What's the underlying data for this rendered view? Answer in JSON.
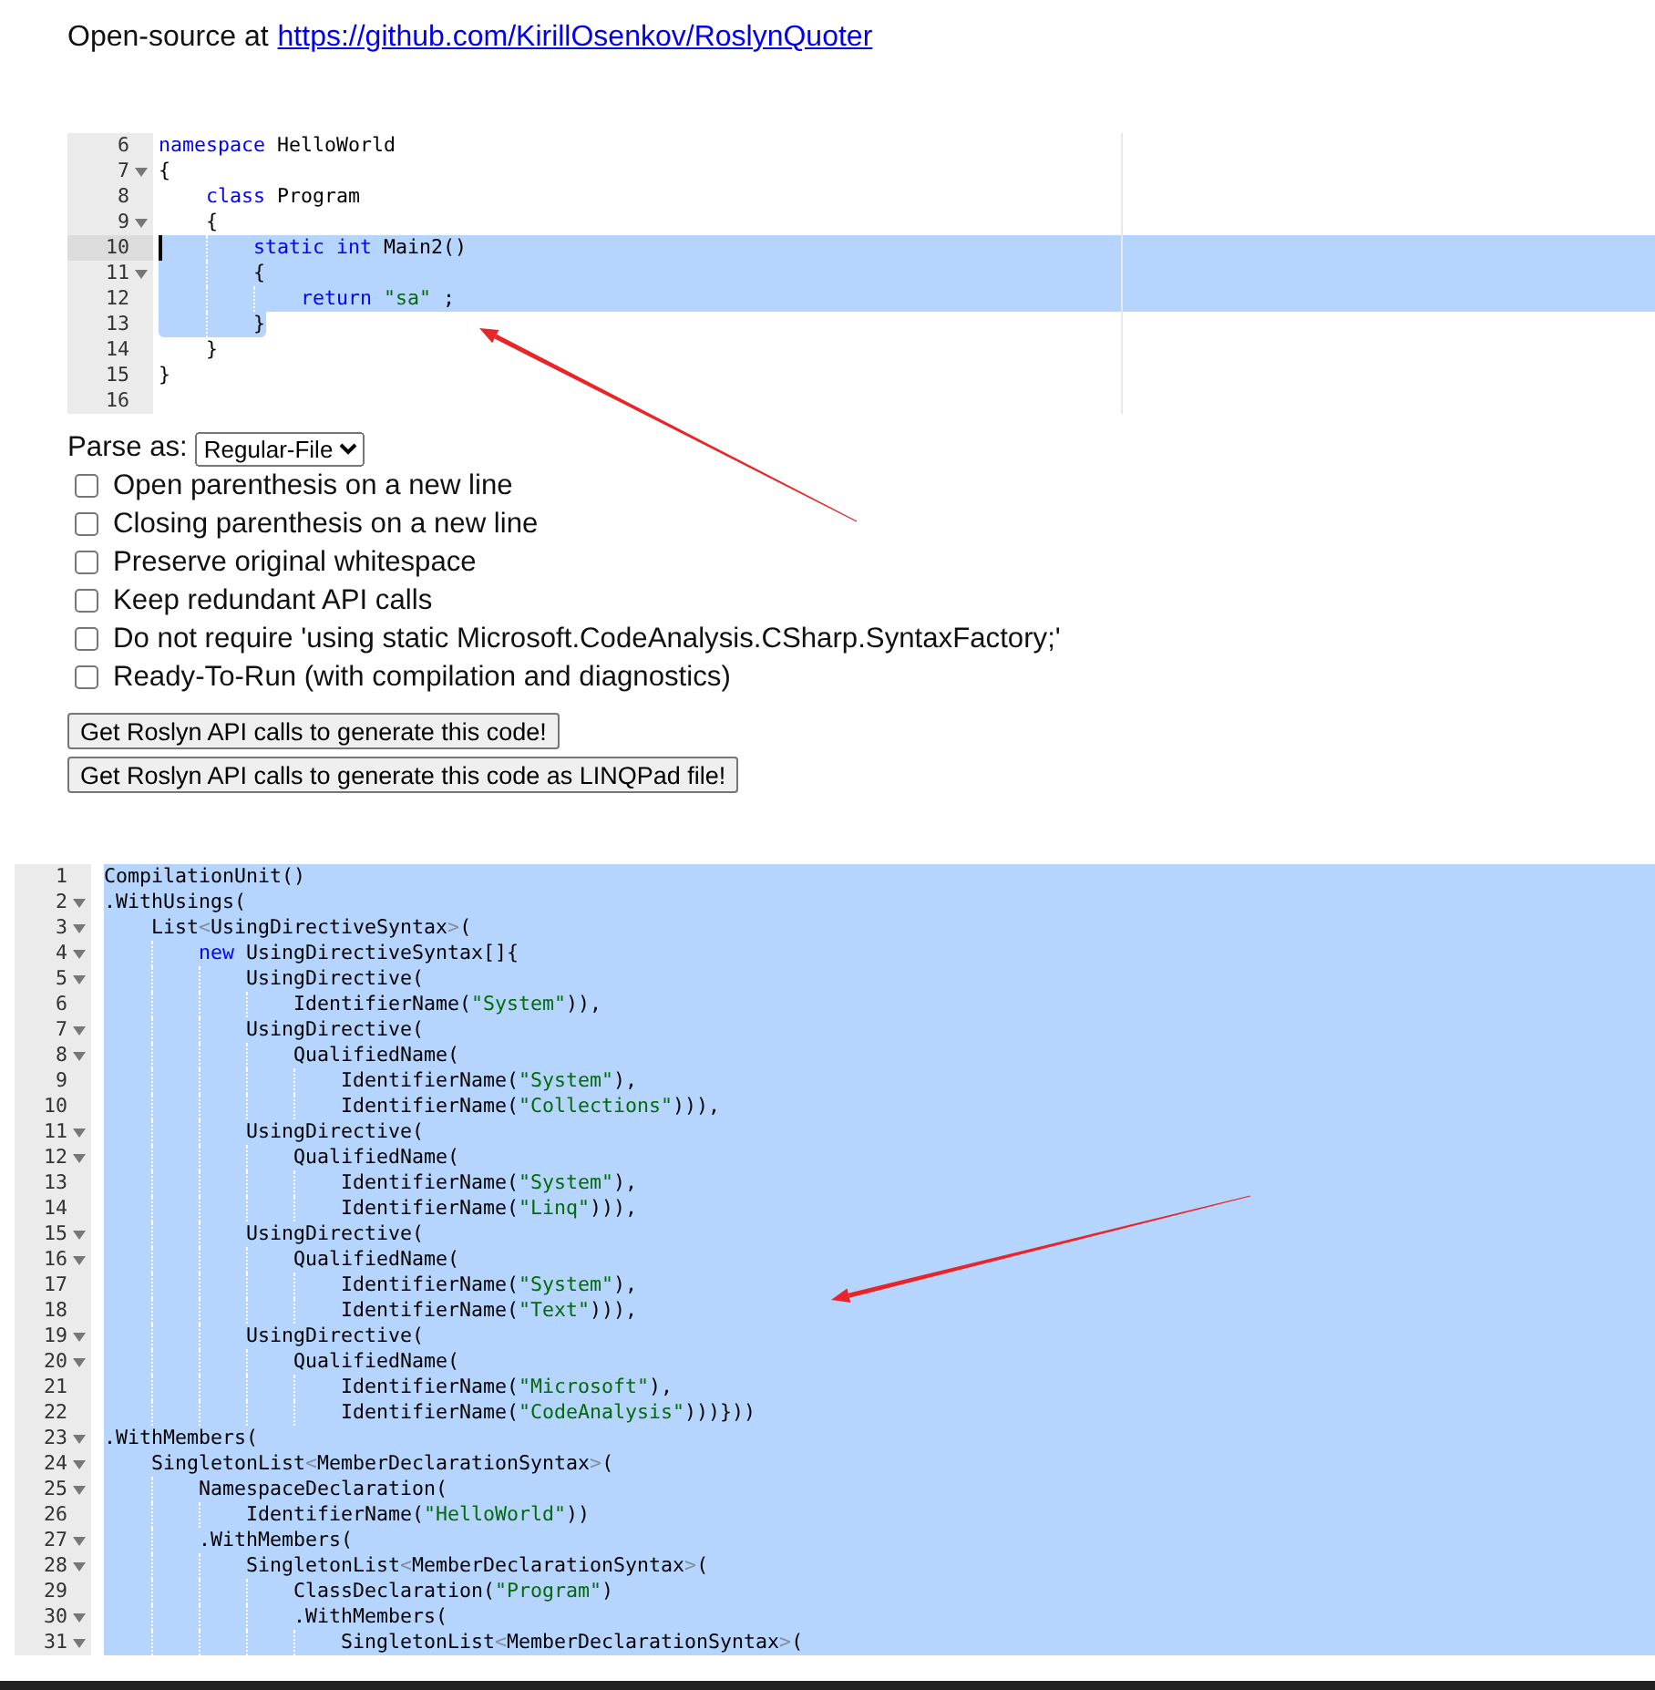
{
  "header": {
    "text": "Open-source at",
    "link": "https://github.com/KirillOsenkov/RoslynQuoter"
  },
  "source_editor": {
    "lines": [
      {
        "number": "6",
        "fold": false,
        "active": false,
        "selected": false,
        "tokens": [
          {
            "kind": "keyword",
            "text": "namespace"
          },
          {
            "kind": "plain",
            "text": " HelloWorld"
          }
        ]
      },
      {
        "number": "7",
        "fold": true,
        "active": false,
        "selected": false,
        "tokens": [
          {
            "kind": "plain",
            "text": "{"
          }
        ],
        "children": [
          {
            "number": "8",
            "fold": false,
            "active": false,
            "selected": false,
            "tokens": [
              {
                "kind": "keyword",
                "text": "class"
              },
              {
                "kind": "plain",
                "text": " Program"
              }
            ]
          },
          {
            "number": "9",
            "fold": true,
            "active": false,
            "selected": false,
            "tokens": [
              {
                "kind": "plain",
                "text": "{"
              }
            ],
            "children": [
              {
                "number": "10",
                "fold": false,
                "active": true,
                "selected": true,
                "tokens": [
                  {
                    "kind": "keyword",
                    "text": "static "
                  },
                  {
                    "kind": "keyword",
                    "text": "int"
                  },
                  {
                    "kind": "plain",
                    "text": " Main2()"
                  }
                ]
              },
              {
                "number": "11",
                "fold": true,
                "active": false,
                "selected": true,
                "tokens": [
                  {
                    "kind": "plain",
                    "text": "{"
                  }
                ],
                "children": [
                  {
                    "number": "12",
                    "fold": false,
                    "active": false,
                    "selected": true,
                    "tokens": [
                      {
                        "kind": "keyword",
                        "text": "return"
                      },
                      {
                        "kind": "string",
                        "text": " \"sa\""
                      },
                      {
                        "kind": "plain",
                        "text": " ;"
                      }
                    ]
                  }
                ]
              },
              {
                "number": "13",
                "fold": false,
                "active": false,
                "selected": true,
                "tokens": [
                  {
                    "kind": "plain",
                    "text": "}"
                  }
                ]
              }
            ]
          },
          {
            "number": "14",
            "fold": false,
            "active": false,
            "selected": false,
            "tokens": [
              {
                "kind": "plain",
                "text": "}"
              }
            ]
          }
        ]
      },
      {
        "number": "15",
        "fold": false,
        "active": false,
        "selected": false,
        "tokens": [
          {
            "kind": "plain",
            "text": "}"
          }
        ]
      },
      {
        "number": "16",
        "fold": false,
        "active": false,
        "selected": false
      }
    ]
  },
  "parse_as": {
    "label": "Parse as:",
    "value": "Regular-File"
  },
  "options": [
    {
      "label": "Open parenthesis on a new line",
      "checked": false
    },
    {
      "label": "Closing parenthesis on a new line",
      "checked": false
    },
    {
      "label": "Preserve original whitespace",
      "checked": false
    },
    {
      "label": "Keep redundant API calls",
      "checked": false
    },
    {
      "label": "Do not require 'using static Microsoft.CodeAnalysis.CSharp.SyntaxFactory;'",
      "checked": false
    },
    {
      "label": "Ready-To-Run (with compilation and diagnostics)",
      "checked": false
    }
  ],
  "buttons": [
    "Get Roslyn API calls to generate this code!",
    "Get Roslyn API calls to generate this code as LINQPad file!"
  ],
  "output_editor": {
    "lines": [
      {
        "number": "1",
        "fold": false,
        "active": false,
        "selected": true,
        "tokens": [
          {
            "kind": "plain",
            "text": "CompilationUnit()"
          }
        ]
      },
      {
        "number": "2",
        "fold": true,
        "active": false,
        "selected": true,
        "tokens": [
          {
            "kind": "plain",
            "text": ".WithUsings("
          }
        ],
        "children": [
          {
            "number": "3",
            "fold": true,
            "active": false,
            "selected": true,
            "tokens": [
              {
                "kind": "plain",
                "text": "List"
              },
              {
                "kind": "bracket",
                "text": "<"
              },
              {
                "kind": "plain",
                "text": "UsingDirectiveSyntax"
              },
              {
                "kind": "bracket",
                "text": ">"
              },
              {
                "kind": "plain",
                "text": "("
              }
            ],
            "children": [
              {
                "number": "4",
                "fold": true,
                "active": false,
                "selected": true,
                "tokens": [
                  {
                    "kind": "keyword",
                    "text": "new"
                  },
                  {
                    "kind": "plain",
                    "text": " UsingDirectiveSyntax[]{"
                  }
                ],
                "children": [
                  {
                    "number": "5",
                    "fold": true,
                    "active": false,
                    "selected": true,
                    "tokens": [
                      {
                        "kind": "plain",
                        "text": "UsingDirective("
                      }
                    ],
                    "children": [
                      {
                        "number": "6",
                        "fold": false,
                        "active": false,
                        "selected": true,
                        "tokens": [
                          {
                            "kind": "plain",
                            "text": "IdentifierName("
                          },
                          {
                            "kind": "string",
                            "text": "\"System\""
                          },
                          {
                            "kind": "plain",
                            "text": ")),"
                          }
                        ]
                      }
                    ]
                  },
                  {
                    "number": "7",
                    "fold": true,
                    "active": false,
                    "selected": true,
                    "tokens": [
                      {
                        "kind": "plain",
                        "text": "UsingDirective("
                      }
                    ],
                    "children": [
                      {
                        "number": "8",
                        "fold": true,
                        "active": false,
                        "selected": true,
                        "tokens": [
                          {
                            "kind": "plain",
                            "text": "QualifiedName("
                          }
                        ],
                        "children": [
                          {
                            "number": "9",
                            "fold": false,
                            "active": false,
                            "selected": true,
                            "tokens": [
                              {
                                "kind": "plain",
                                "text": "IdentifierName("
                              },
                              {
                                "kind": "string",
                                "text": "\"System\""
                              },
                              {
                                "kind": "plain",
                                "text": "),"
                              }
                            ]
                          },
                          {
                            "number": "10",
                            "fold": false,
                            "active": false,
                            "selected": true,
                            "tokens": [
                              {
                                "kind": "plain",
                                "text": "IdentifierName("
                              },
                              {
                                "kind": "string",
                                "text": "\"Collections\""
                              },
                              {
                                "kind": "plain",
                                "text": "))),"
                              }
                            ]
                          }
                        ]
                      }
                    ]
                  },
                  {
                    "number": "11",
                    "fold": true,
                    "active": false,
                    "selected": true,
                    "tokens": [
                      {
                        "kind": "plain",
                        "text": "UsingDirective("
                      }
                    ],
                    "children": [
                      {
                        "number": "12",
                        "fold": true,
                        "active": false,
                        "selected": true,
                        "tokens": [
                          {
                            "kind": "plain",
                            "text": "QualifiedName("
                          }
                        ],
                        "children": [
                          {
                            "number": "13",
                            "fold": false,
                            "active": false,
                            "selected": true,
                            "tokens": [
                              {
                                "kind": "plain",
                                "text": "IdentifierName("
                              },
                              {
                                "kind": "string",
                                "text": "\"System\""
                              },
                              {
                                "kind": "plain",
                                "text": "),"
                              }
                            ]
                          },
                          {
                            "number": "14",
                            "fold": false,
                            "active": false,
                            "selected": true,
                            "tokens": [
                              {
                                "kind": "plain",
                                "text": "IdentifierName("
                              },
                              {
                                "kind": "string",
                                "text": "\"Linq\""
                              },
                              {
                                "kind": "plain",
                                "text": "))),"
                              }
                            ]
                          }
                        ]
                      }
                    ]
                  },
                  {
                    "number": "15",
                    "fold": true,
                    "active": false,
                    "selected": true,
                    "tokens": [
                      {
                        "kind": "plain",
                        "text": "UsingDirective("
                      }
                    ],
                    "children": [
                      {
                        "number": "16",
                        "fold": true,
                        "active": false,
                        "selected": true,
                        "tokens": [
                          {
                            "kind": "plain",
                            "text": "QualifiedName("
                          }
                        ],
                        "children": [
                          {
                            "number": "17",
                            "fold": false,
                            "active": false,
                            "selected": true,
                            "tokens": [
                              {
                                "kind": "plain",
                                "text": "IdentifierName("
                              },
                              {
                                "kind": "string",
                                "text": "\"System\""
                              },
                              {
                                "kind": "plain",
                                "text": "),"
                              }
                            ]
                          },
                          {
                            "number": "18",
                            "fold": false,
                            "active": false,
                            "selected": true,
                            "tokens": [
                              {
                                "kind": "plain",
                                "text": "IdentifierName("
                              },
                              {
                                "kind": "string",
                                "text": "\"Text\""
                              },
                              {
                                "kind": "plain",
                                "text": "))),"
                              }
                            ]
                          }
                        ]
                      }
                    ]
                  },
                  {
                    "number": "19",
                    "fold": true,
                    "active": false,
                    "selected": true,
                    "tokens": [
                      {
                        "kind": "plain",
                        "text": "UsingDirective("
                      }
                    ],
                    "children": [
                      {
                        "number": "20",
                        "fold": true,
                        "active": false,
                        "selected": true,
                        "tokens": [
                          {
                            "kind": "plain",
                            "text": "QualifiedName("
                          }
                        ],
                        "children": [
                          {
                            "number": "21",
                            "fold": false,
                            "active": false,
                            "selected": true,
                            "tokens": [
                              {
                                "kind": "plain",
                                "text": "IdentifierName("
                              },
                              {
                                "kind": "string",
                                "text": "\"Microsoft\""
                              },
                              {
                                "kind": "plain",
                                "text": "),"
                              }
                            ]
                          },
                          {
                            "number": "22",
                            "fold": false,
                            "active": false,
                            "selected": true,
                            "tokens": [
                              {
                                "kind": "plain",
                                "text": "IdentifierName("
                              },
                              {
                                "kind": "string",
                                "text": "\"CodeAnalysis\""
                              },
                              {
                                "kind": "plain",
                                "text": ")))}))"
                              }
                            ]
                          }
                        ]
                      }
                    ]
                  }
                ]
              }
            ]
          }
        ]
      },
      {
        "number": "23",
        "fold": true,
        "active": false,
        "selected": true,
        "tokens": [
          {
            "kind": "plain",
            "text": ".WithMembers("
          }
        ],
        "children": [
          {
            "number": "24",
            "fold": true,
            "active": false,
            "selected": true,
            "tokens": [
              {
                "kind": "plain",
                "text": "SingletonList"
              },
              {
                "kind": "bracket",
                "text": "<"
              },
              {
                "kind": "plain",
                "text": "MemberDeclarationSyntax"
              },
              {
                "kind": "bracket",
                "text": ">"
              },
              {
                "kind": "plain",
                "text": "("
              }
            ],
            "children": [
              {
                "number": "25",
                "fold": true,
                "active": false,
                "selected": true,
                "tokens": [
                  {
                    "kind": "plain",
                    "text": "NamespaceDeclaration("
                  }
                ],
                "children": [
                  {
                    "number": "26",
                    "fold": false,
                    "active": false,
                    "selected": true,
                    "tokens": [
                      {
                        "kind": "plain",
                        "text": "IdentifierName("
                      },
                      {
                        "kind": "string",
                        "text": "\"HelloWorld\""
                      },
                      {
                        "kind": "plain",
                        "text": "))"
                      }
                    ]
                  }
                ]
              },
              {
                "number": "27",
                "fold": true,
                "active": false,
                "selected": true,
                "tokens": [
                  {
                    "kind": "plain",
                    "text": ".WithMembers("
                  }
                ],
                "children": [
                  {
                    "number": "28",
                    "fold": true,
                    "active": false,
                    "selected": true,
                    "tokens": [
                      {
                        "kind": "plain",
                        "text": "SingletonList"
                      },
                      {
                        "kind": "bracket",
                        "text": "<"
                      },
                      {
                        "kind": "plain",
                        "text": "MemberDeclarationSyntax"
                      },
                      {
                        "kind": "bracket",
                        "text": ">"
                      },
                      {
                        "kind": "plain",
                        "text": "("
                      }
                    ],
                    "children": [
                      {
                        "number": "29",
                        "fold": false,
                        "active": false,
                        "selected": true,
                        "tokens": [
                          {
                            "kind": "plain",
                            "text": "ClassDeclaration("
                          },
                          {
                            "kind": "string",
                            "text": "\"Program\""
                          },
                          {
                            "kind": "plain",
                            "text": ")"
                          }
                        ]
                      },
                      {
                        "number": "30",
                        "fold": true,
                        "active": false,
                        "selected": true,
                        "tokens": [
                          {
                            "kind": "plain",
                            "text": ".WithMembers("
                          }
                        ],
                        "children": [
                          {
                            "number": "31",
                            "fold": true,
                            "active": false,
                            "selected": true,
                            "tokens": [
                              {
                                "kind": "plain",
                                "text": "SingletonList"
                              },
                              {
                                "kind": "bracket",
                                "text": "<"
                              },
                              {
                                "kind": "plain",
                                "text": "MemberDeclarationSyntax"
                              },
                              {
                                "kind": "bracket",
                                "text": ">"
                              },
                              {
                                "kind": "plain",
                                "text": "("
                              }
                            ]
                          }
                        ]
                      }
                    ]
                  }
                ]
              }
            ]
          }
        ]
      }
    ]
  }
}
